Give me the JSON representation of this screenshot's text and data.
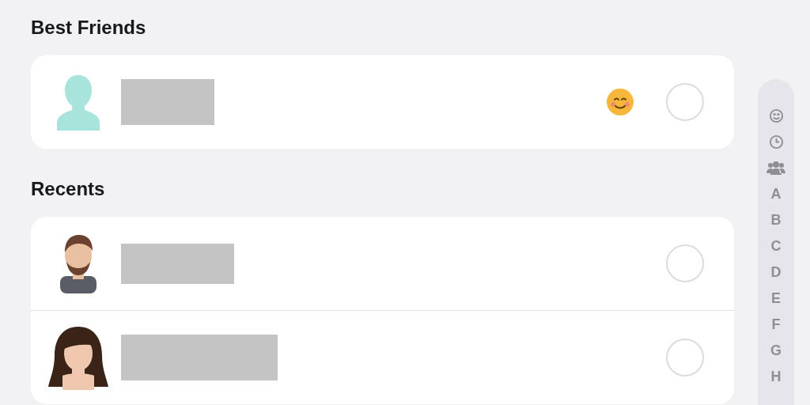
{
  "sections": [
    {
      "title": "Best Friends",
      "rows": [
        {
          "kind": "silhouette",
          "name_redacted": true,
          "has_emoji": true,
          "selected": false
        }
      ]
    },
    {
      "title": "Recents",
      "rows": [
        {
          "kind": "man",
          "name_redacted": true,
          "has_emoji": false,
          "selected": false
        },
        {
          "kind": "woman",
          "name_redacted": true,
          "has_emoji": false,
          "selected": false
        }
      ]
    }
  ],
  "index": [
    {
      "kind": "smiley"
    },
    {
      "kind": "clock"
    },
    {
      "kind": "group"
    },
    {
      "kind": "letter",
      "label": "A"
    },
    {
      "kind": "letter",
      "label": "B"
    },
    {
      "kind": "letter",
      "label": "C"
    },
    {
      "kind": "letter",
      "label": "D"
    },
    {
      "kind": "letter",
      "label": "E"
    },
    {
      "kind": "letter",
      "label": "F"
    },
    {
      "kind": "letter",
      "label": "G"
    },
    {
      "kind": "letter",
      "label": "H"
    }
  ]
}
